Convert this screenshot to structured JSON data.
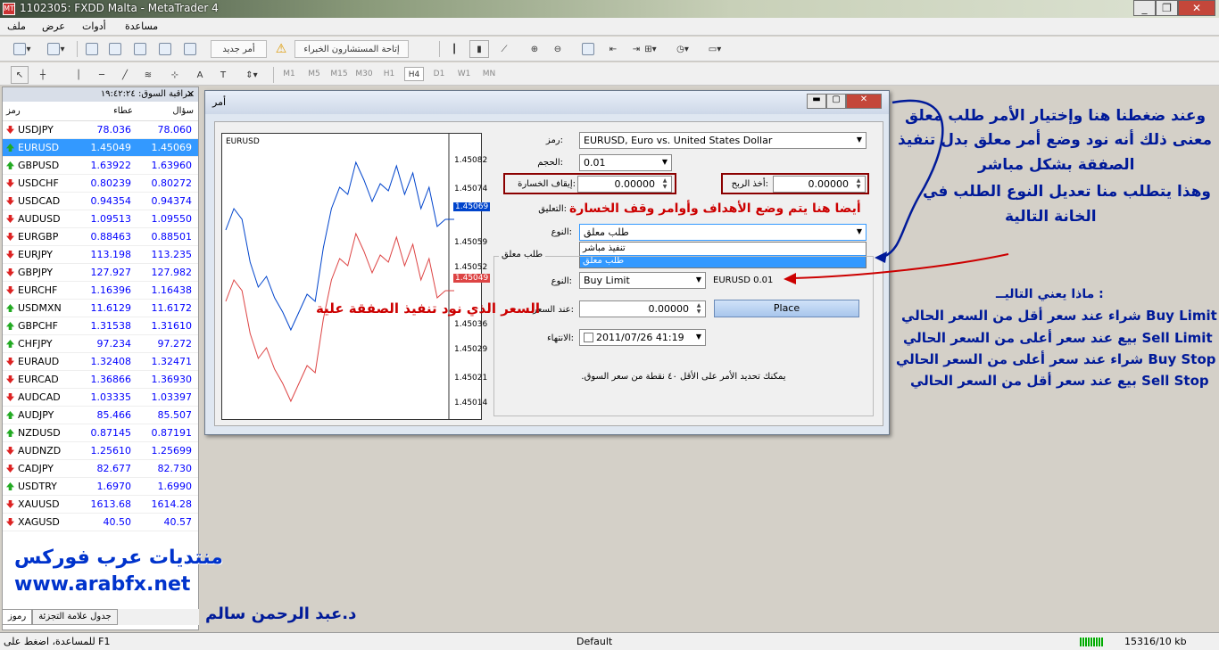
{
  "window": {
    "title": "1102305: FXDD Malta - MetaTrader 4",
    "icon_text": "MT"
  },
  "menu": [
    "ملف",
    "عرض",
    "أدوات",
    "مساعدة"
  ],
  "toolbar": {
    "new_order": "أمر جديد",
    "experts": "إتاحة المستشارون الخبراء",
    "timeframes": [
      "M1",
      "M5",
      "M15",
      "M30",
      "H1",
      "H4",
      "D1",
      "W1",
      "MN"
    ],
    "active_tf": "H4"
  },
  "market_watch": {
    "header": "مراقبة السوق: ١٩:٤٢:٢٤",
    "col_symbol": "رمز",
    "col_bid": "عطاء",
    "col_ask": "سؤال",
    "rows": [
      {
        "s": "USDJPY",
        "b": "78.036",
        "a": "78.060",
        "d": "down"
      },
      {
        "s": "EURUSD",
        "b": "1.45049",
        "a": "1.45069",
        "d": "up",
        "sel": true
      },
      {
        "s": "GBPUSD",
        "b": "1.63922",
        "a": "1.63960",
        "d": "up"
      },
      {
        "s": "USDCHF",
        "b": "0.80239",
        "a": "0.80272",
        "d": "down"
      },
      {
        "s": "USDCAD",
        "b": "0.94354",
        "a": "0.94374",
        "d": "down"
      },
      {
        "s": "AUDUSD",
        "b": "1.09513",
        "a": "1.09550",
        "d": "down"
      },
      {
        "s": "EURGBP",
        "b": "0.88463",
        "a": "0.88501",
        "d": "down"
      },
      {
        "s": "EURJPY",
        "b": "113.198",
        "a": "113.235",
        "d": "down"
      },
      {
        "s": "GBPJPY",
        "b": "127.927",
        "a": "127.982",
        "d": "down"
      },
      {
        "s": "EURCHF",
        "b": "1.16396",
        "a": "1.16438",
        "d": "down"
      },
      {
        "s": "USDMXN",
        "b": "11.6129",
        "a": "11.6172",
        "d": "up"
      },
      {
        "s": "GBPCHF",
        "b": "1.31538",
        "a": "1.31610",
        "d": "up"
      },
      {
        "s": "CHFJPY",
        "b": "97.234",
        "a": "97.272",
        "d": "up"
      },
      {
        "s": "EURAUD",
        "b": "1.32408",
        "a": "1.32471",
        "d": "down"
      },
      {
        "s": "EURCAD",
        "b": "1.36866",
        "a": "1.36930",
        "d": "down"
      },
      {
        "s": "AUDCAD",
        "b": "1.03335",
        "a": "1.03397",
        "d": "down"
      },
      {
        "s": "AUDJPY",
        "b": "85.466",
        "a": "85.507",
        "d": "up"
      },
      {
        "s": "NZDUSD",
        "b": "0.87145",
        "a": "0.87191",
        "d": "up"
      },
      {
        "s": "AUDNZD",
        "b": "1.25610",
        "a": "1.25699",
        "d": "down"
      },
      {
        "s": "CADJPY",
        "b": "82.677",
        "a": "82.730",
        "d": "down"
      },
      {
        "s": "USDTRY",
        "b": "1.6970",
        "a": "1.6990",
        "d": "up"
      },
      {
        "s": "XAUUSD",
        "b": "1613.68",
        "a": "1614.28",
        "d": "down"
      },
      {
        "s": "XAGUSD",
        "b": "40.50",
        "a": "40.57",
        "d": "down"
      }
    ],
    "tabs": [
      "رموز",
      "جدول علامة التجزئة"
    ]
  },
  "promo": {
    "line1": "منتديات عرب فوركس",
    "line2": "www.arabfx.net"
  },
  "author": "د.عبد الرحمن سالم",
  "status": {
    "help": "للمساعدة، اضغط على F1",
    "profile": "Default",
    "traffic": "15316/10 kb"
  },
  "dialog": {
    "title": "أمر",
    "chart_symbol": "EURUSD",
    "yticks": [
      "1.45082",
      "1.45074",
      "1.45069",
      "1.45059",
      "1.45052",
      "1.45049",
      "1.45036",
      "1.45029",
      "1.45021",
      "1.45014"
    ],
    "ask_label": "1.45069",
    "bid_label": "1.45049",
    "symbol_label": "رمز:",
    "symbol_value": "EURUSD, Euro vs. United States Dollar",
    "volume_label": "الحجم:",
    "volume_value": "0.01",
    "sl_label": "إيقاف الخسارة:",
    "sl_value": "0.00000",
    "tp_label": "أخذ الربح:",
    "tp_value": "0.00000",
    "comment_label": "التعليق:",
    "type_label": "النوع:",
    "type_value": "طلب معلق",
    "type_options": [
      "تنفيذ مباشر",
      "طلب معلق"
    ],
    "pending_group": "طلب معلق",
    "pending_type_label": "النوع:",
    "pending_type_value": "Buy Limit",
    "pending_symbol": "EURUSD 0.01",
    "price_label": "عند السعر:",
    "price_value": "0.00000",
    "place": "Place",
    "expiry_label": "الانتهاء:",
    "expiry_value": "2011/07/26 41:19",
    "note": ".يمكنك تحديد الأمر على الأقل ٤٠ نقطة من سعر السوق"
  },
  "annotations": {
    "top_right": [
      "وعند ضغطنا هنا وإختيار الأمر طلب معلق",
      "معنى ذلك أنه نود وضع أمر معلق بدل تنفيذ",
      "الصفقة بشكل مباشر",
      "وهذا يتطلب منا تعديل النوع الطلب في",
      "الخانة التالية"
    ],
    "sl_tp": "أيضا هنا يتم وضع الأهداف وأوامر وقف الخسارة",
    "price": "السعر الذي نود تنفيذ الصفقة علية",
    "meaning_title": "ماذا يعني التاليــ :",
    "meanings": [
      "شراء عند سعر أقل من السعر الحالي Buy Limit",
      "بيع عند سعر أعلى من السعر الحالي Sell Limit",
      "شراء عند سعر أعلى من السعر الحالي Buy Stop",
      "بيع عند سعر أقل من السعر الحالي Sell Stop"
    ]
  },
  "chart_data": {
    "type": "line",
    "ylim": [
      1.4501,
      1.4509
    ],
    "series": [
      {
        "values": [
          1.45063,
          1.45069,
          1.45066,
          1.45054,
          1.45047,
          1.4505,
          1.45044,
          1.4504,
          1.45035,
          1.4504,
          1.45045,
          1.45043,
          1.45058,
          1.45069,
          1.45075,
          1.45073,
          1.45082,
          1.45077,
          1.45071,
          1.45076,
          1.45074,
          1.45081,
          1.45073,
          1.45079,
          1.45069,
          1.45075,
          1.45064,
          1.45066
        ]
      },
      {
        "values": [
          1.45043,
          1.45049,
          1.45046,
          1.45034,
          1.45027,
          1.4503,
          1.45024,
          1.4502,
          1.45015,
          1.4502,
          1.45025,
          1.45023,
          1.45038,
          1.45049,
          1.45055,
          1.45053,
          1.45062,
          1.45057,
          1.45051,
          1.45056,
          1.45054,
          1.45061,
          1.45053,
          1.45059,
          1.45049,
          1.45055,
          1.45044,
          1.45046
        ]
      }
    ],
    "colors": [
      "#0044cc",
      "#dd4444"
    ]
  }
}
